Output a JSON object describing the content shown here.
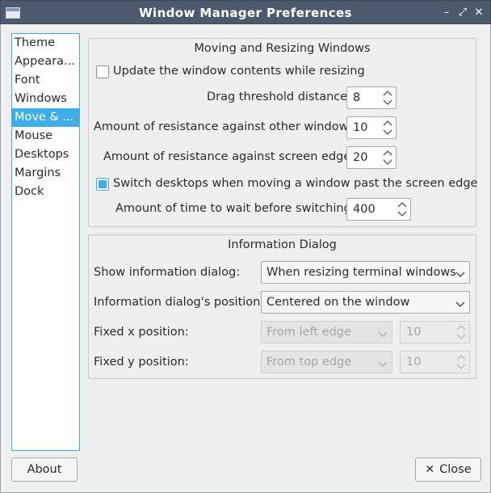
{
  "window": {
    "title": "Window Manager Preferences",
    "controls": {
      "minimize": "–",
      "maximize": "⤢",
      "close": "✕"
    }
  },
  "sidebar": {
    "items": [
      {
        "label": "Theme",
        "selected": false
      },
      {
        "label": "Appearance",
        "display": "Appeara...",
        "selected": false
      },
      {
        "label": "Font",
        "selected": false
      },
      {
        "label": "Windows",
        "selected": false
      },
      {
        "label": "Move & ...",
        "selected": true
      },
      {
        "label": "Mouse",
        "selected": false
      },
      {
        "label": "Desktops",
        "selected": false
      },
      {
        "label": "Margins",
        "selected": false
      },
      {
        "label": "Dock",
        "selected": false
      }
    ]
  },
  "moving": {
    "title": "Moving and Resizing Windows",
    "update_contents_label": "Update the window contents while resizing",
    "update_contents_checked": false,
    "drag_threshold_label": "Drag threshold distance:",
    "drag_threshold_value": "8",
    "resist_windows_label": "Amount of resistance against other windows:",
    "resist_windows_value": "10",
    "resist_edges_label": "Amount of resistance against screen edges:",
    "resist_edges_value": "20",
    "switch_desktops_label": "Switch desktops when moving a window past the screen edge",
    "switch_desktops_checked": true,
    "wait_time_label": "Amount of time to wait before switching:",
    "wait_time_value": "400"
  },
  "info": {
    "title": "Information Dialog",
    "show_label": "Show information dialog:",
    "show_value": "When resizing terminal windows",
    "position_label": "Information dialog's position:",
    "position_value": "Centered on the window",
    "fixed_x_label": "Fixed x position:",
    "fixed_x_combo": "From left edge",
    "fixed_x_value": "10",
    "fixed_y_label": "Fixed y position:",
    "fixed_y_combo": "From top edge",
    "fixed_y_value": "10"
  },
  "buttons": {
    "about": "About",
    "close": "Close"
  },
  "colors": {
    "titlebar": "#4d5a6d",
    "accent": "#3daee9",
    "background": "#efefef"
  }
}
